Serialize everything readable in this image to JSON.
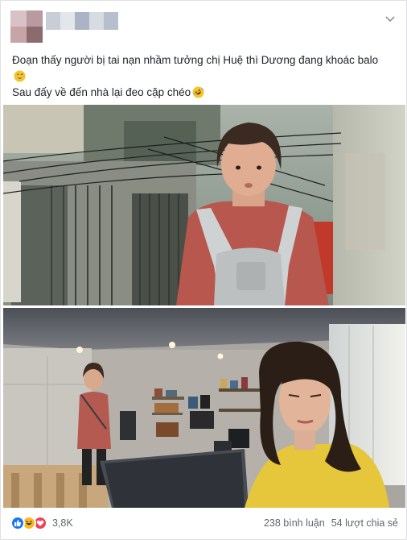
{
  "post": {
    "line1": "Đoạn thấy người bị tai nạn nhầm tưởng chị Huệ thì Dương đang khoác balo",
    "line2_emoji": "grinning-sweat-emoji",
    "line3": "Sau đấy về đến nhà lại đeo cặp chéo",
    "line3_emoji": "rofl-emoji"
  },
  "header": {
    "avatar_colors": [
      "#d9c2c6",
      "#b89aa0",
      "#c7a4a8",
      "#8c6a6e"
    ],
    "name_blur_colors": [
      "#c9ced6",
      "#e3e6ea",
      "#aab4c4",
      "#d7dbe2",
      "#b7bfcc"
    ],
    "menu_icon": "chevron-down-icon"
  },
  "media": [
    {
      "description_icon": "video-frame-1"
    },
    {
      "description_icon": "video-frame-2"
    }
  ],
  "footer": {
    "reaction_icons": [
      "like-icon",
      "haha-icon",
      "love-icon"
    ],
    "reaction_count": "3,8K",
    "comments": "238 bình luận",
    "shares": "54 lượt chia sẻ"
  },
  "colors": {
    "like": "#1877f2",
    "haha": "#f7b928",
    "love": "#f33e58",
    "text": "#1d2129",
    "muted": "#606770"
  }
}
